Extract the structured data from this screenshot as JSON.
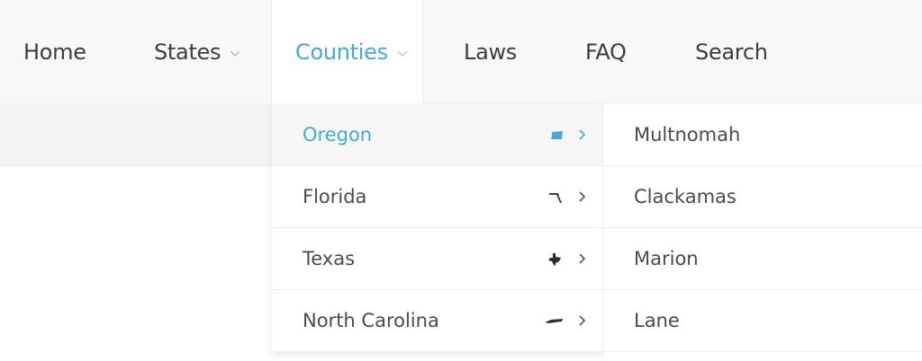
{
  "nav": {
    "items": [
      {
        "label": "Home",
        "dropdown": false
      },
      {
        "label": "States",
        "dropdown": true
      },
      {
        "label": "Counties",
        "dropdown": true,
        "active": true
      },
      {
        "label": "Laws",
        "dropdown": false
      },
      {
        "label": "FAQ",
        "dropdown": false
      },
      {
        "label": "Search",
        "dropdown": false
      }
    ]
  },
  "states_menu": {
    "items": [
      {
        "label": "Oregon",
        "icon": "oregon-shape-icon",
        "active": true
      },
      {
        "label": "Florida",
        "icon": "florida-shape-icon"
      },
      {
        "label": "Texas",
        "icon": "texas-shape-icon"
      },
      {
        "label": "North Carolina",
        "icon": "north-carolina-shape-icon"
      }
    ]
  },
  "counties_menu": {
    "items": [
      {
        "label": "Multnomah"
      },
      {
        "label": "Clackamas"
      },
      {
        "label": "Marion"
      },
      {
        "label": "Lane"
      }
    ]
  },
  "colors": {
    "accent": "#45a9d3",
    "text": "#3d3d3d",
    "navbar_bg": "#f8f8f8"
  }
}
